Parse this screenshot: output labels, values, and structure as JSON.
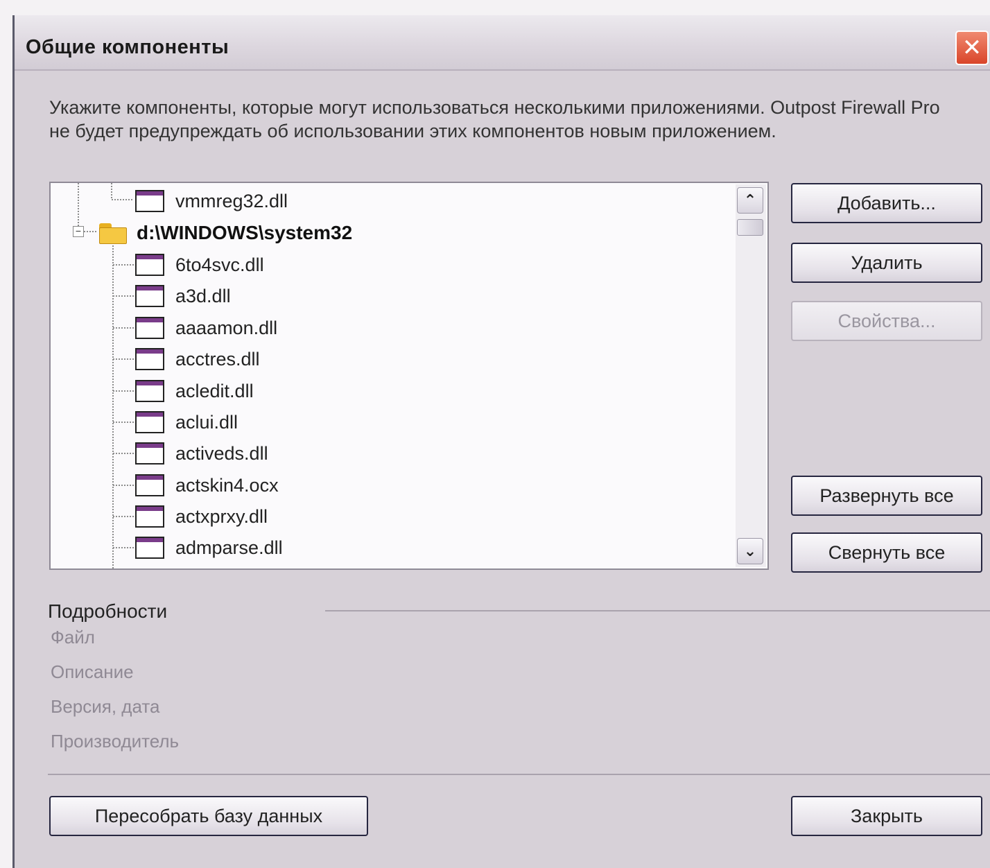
{
  "window": {
    "title": "Общие компоненты",
    "close_label": "✕"
  },
  "description": "Укажите компоненты, которые могут использоваться несколькими приложениями. Outpost Firewall Pro не будет предупреждать об использовании этих компонентов новым приложением.",
  "tree": {
    "items": [
      {
        "label": "vmmreg32.dll",
        "type": "file"
      },
      {
        "label": "d:\\WINDOWS\\system32",
        "type": "folder"
      },
      {
        "label": "6to4svc.dll",
        "type": "file"
      },
      {
        "label": "a3d.dll",
        "type": "file"
      },
      {
        "label": "aaaamon.dll",
        "type": "file"
      },
      {
        "label": "acctres.dll",
        "type": "file"
      },
      {
        "label": "acledit.dll",
        "type": "file"
      },
      {
        "label": "aclui.dll",
        "type": "file"
      },
      {
        "label": "activeds.dll",
        "type": "file"
      },
      {
        "label": "actskin4.ocx",
        "type": "file"
      },
      {
        "label": "actxprxy.dll",
        "type": "file"
      },
      {
        "label": "admparse.dll",
        "type": "file"
      }
    ],
    "scroll_up_icon": "chevron-up-icon",
    "scroll_down_icon": "chevron-down-icon"
  },
  "buttons": {
    "add": "Добавить...",
    "remove": "Удалить",
    "properties": "Свойства...",
    "expand_all": "Развернуть все",
    "collapse_all": "Свернуть все",
    "rebuild_db": "Пересобрать базу данных",
    "close": "Закрыть"
  },
  "details": {
    "heading": "Подробности",
    "file_label": "Файл",
    "description_label": "Описание",
    "version_label": "Версия, дата",
    "vendor_label": "Производитель"
  },
  "colors": {
    "dialog_bg": "#d7d1d8",
    "close_button": "#d9452a",
    "dll_icon_bar": "#7a3c8a"
  }
}
